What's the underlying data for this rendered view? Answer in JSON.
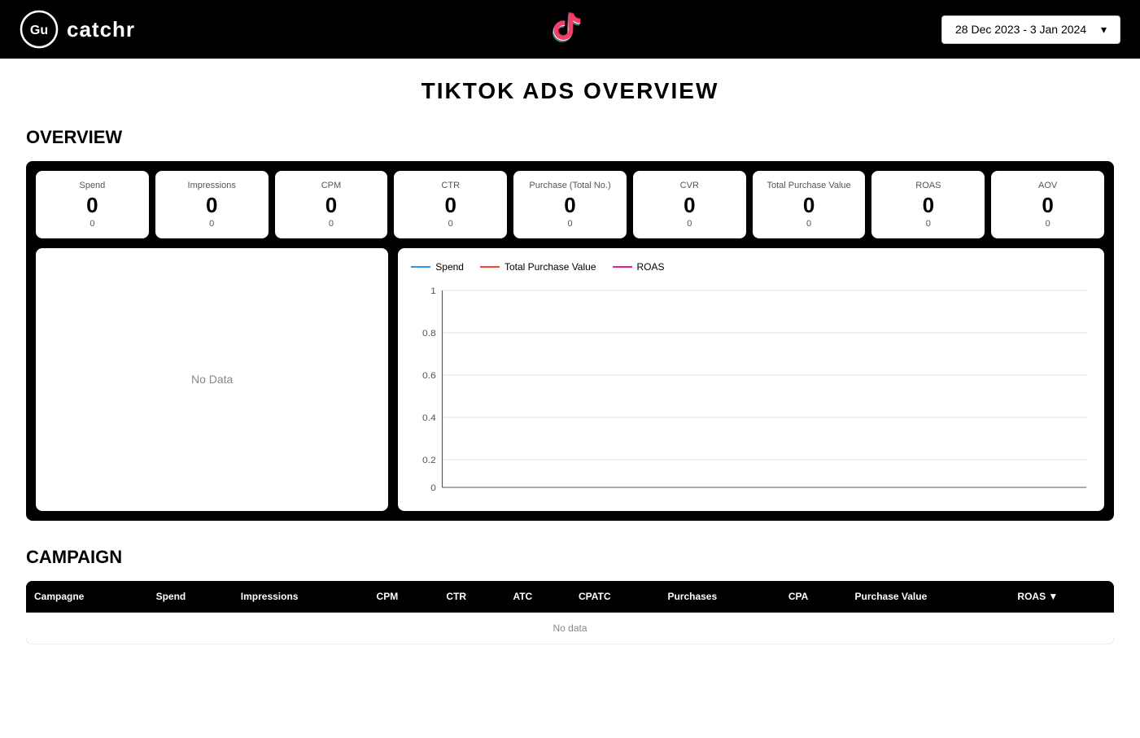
{
  "header": {
    "logo_text": "catchr",
    "date_label": "28 Dec 2023 - 3 Jan 2024"
  },
  "page": {
    "title": "TIKTOK ADS OVERVIEW"
  },
  "overview": {
    "section_title": "OVERVIEW",
    "metrics": [
      {
        "label": "Spend",
        "value": "0",
        "sub": "0"
      },
      {
        "label": "Impressions",
        "value": "0",
        "sub": "0"
      },
      {
        "label": "CPM",
        "value": "0",
        "sub": "0"
      },
      {
        "label": "CTR",
        "value": "0",
        "sub": "0"
      },
      {
        "label": "Purchase (Total No.)",
        "value": "0",
        "sub": "0"
      },
      {
        "label": "CVR",
        "value": "0",
        "sub": "0"
      },
      {
        "label": "Total Purchase Value",
        "value": "0",
        "sub": "0"
      },
      {
        "label": "ROAS",
        "value": "0",
        "sub": "0"
      },
      {
        "label": "AOV",
        "value": "0",
        "sub": "0"
      }
    ],
    "chart_left_no_data": "No Data",
    "chart_legend": [
      {
        "label": "Spend",
        "color": "blue"
      },
      {
        "label": "Total Purchase Value",
        "color": "red"
      },
      {
        "label": "ROAS",
        "color": "pink"
      }
    ],
    "chart_y_values": [
      "1",
      "0.8",
      "0.6",
      "0.4",
      "0.2",
      "0"
    ],
    "chart_x_baseline": "0"
  },
  "campaign": {
    "section_title": "CAMPAIGN",
    "table_headers": [
      {
        "key": "campagne",
        "label": "Campagne"
      },
      {
        "key": "spend",
        "label": "Spend"
      },
      {
        "key": "impressions",
        "label": "Impressions"
      },
      {
        "key": "cpm",
        "label": "CPM"
      },
      {
        "key": "ctr",
        "label": "CTR"
      },
      {
        "key": "atc",
        "label": "ATC"
      },
      {
        "key": "cpatc",
        "label": "CPATC"
      },
      {
        "key": "purchases",
        "label": "Purchases"
      },
      {
        "key": "cpa",
        "label": "CPA"
      },
      {
        "key": "purchase_value",
        "label": "Purchase Value"
      },
      {
        "key": "roas",
        "label": "ROAS ▼"
      }
    ],
    "no_data_text": "No data"
  }
}
